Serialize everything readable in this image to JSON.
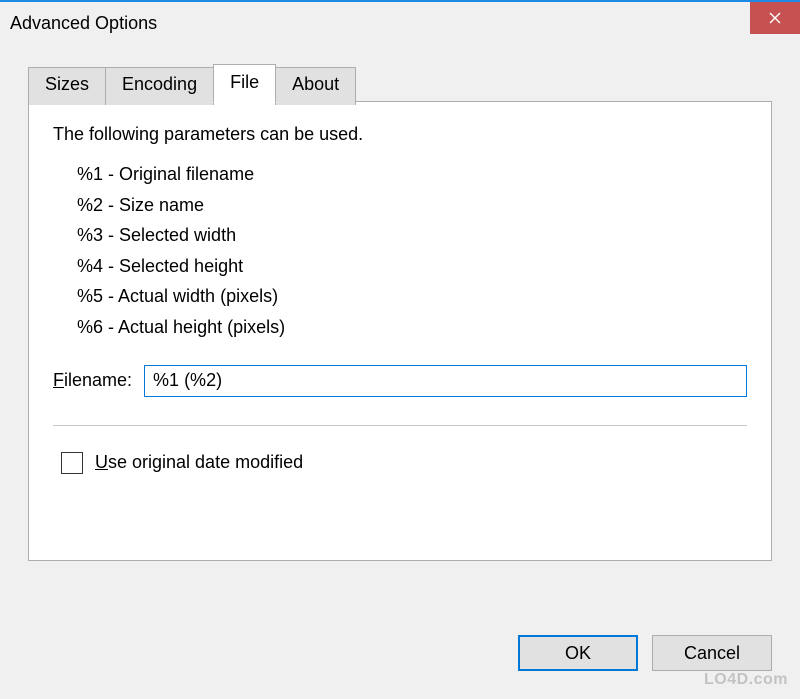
{
  "window": {
    "title": "Advanced Options"
  },
  "tabs": [
    {
      "label": "Sizes"
    },
    {
      "label": "Encoding"
    },
    {
      "label": "File"
    },
    {
      "label": "About"
    }
  ],
  "panel": {
    "intro": "The following parameters can be used.",
    "params": [
      "%1 - Original filename",
      "%2 - Size name",
      "%3 - Selected width",
      "%4 - Selected height",
      "%5 - Actual width (pixels)",
      "%6 - Actual height (pixels)"
    ],
    "filename_label_pre": "F",
    "filename_label_post": "ilename:",
    "filename_value": "%1 (%2)",
    "checkbox_pre": "U",
    "checkbox_post": "se original date modified"
  },
  "buttons": {
    "ok": "OK",
    "cancel": "Cancel"
  },
  "watermark": "LO4D.com"
}
